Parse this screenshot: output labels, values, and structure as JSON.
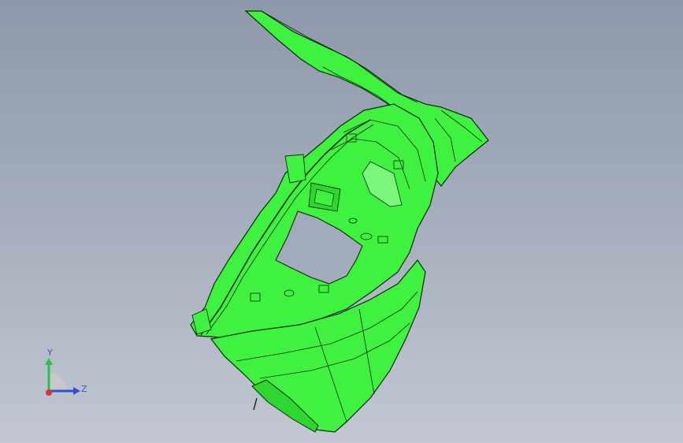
{
  "viewport": {
    "background_top": "#8d98aa",
    "background_bottom": "#c2c7d1"
  },
  "model": {
    "icon": "green-3d-part-model",
    "fill_color": "#3ff23f",
    "edge_color": "#0c2a0c"
  },
  "triad": {
    "icon": "coordinate-triad-icon",
    "y_label": "Y",
    "z_label": "Z",
    "y_color": "#27c24c",
    "z_color": "#2f4fd6",
    "x_color": "#e03030"
  }
}
